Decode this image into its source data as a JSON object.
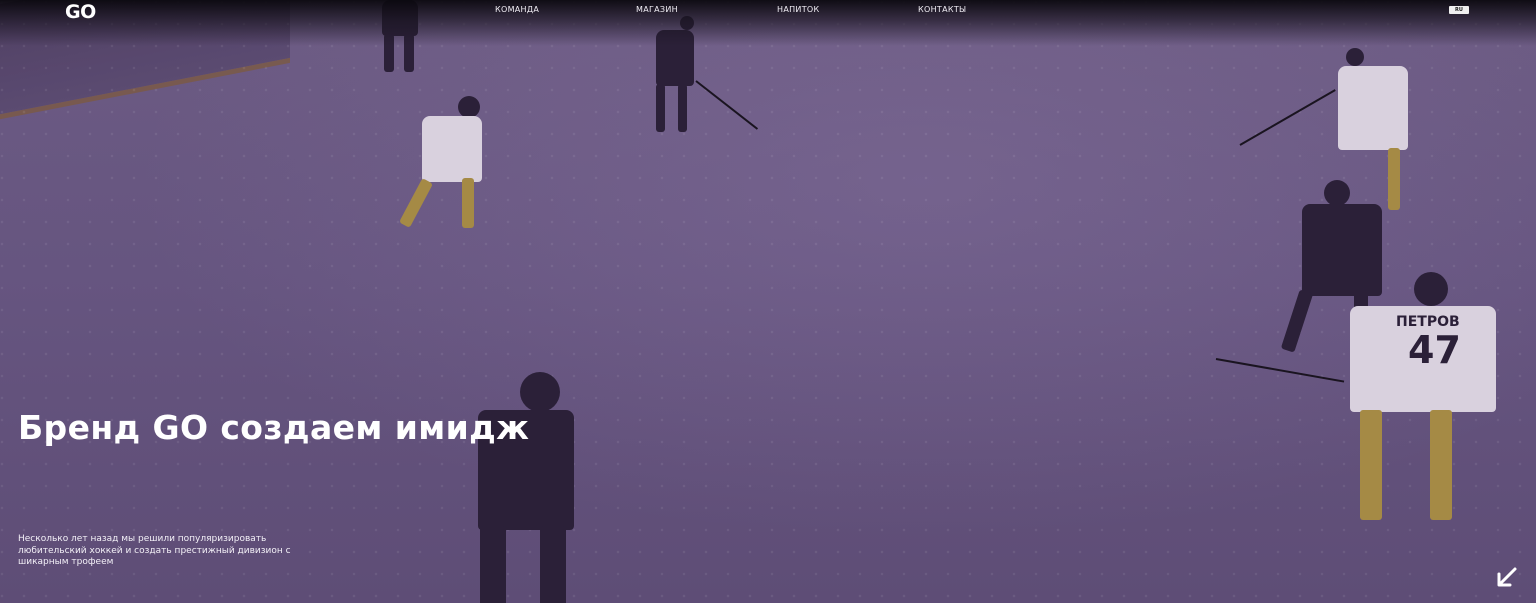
{
  "brand": {
    "logo_text": "GO"
  },
  "nav": {
    "items": [
      {
        "label": "КОМАНДА"
      },
      {
        "label": "МАГАЗИН"
      },
      {
        "label": "НАПИТОК"
      },
      {
        "label": "КОНТАКТЫ"
      }
    ],
    "language": "RU"
  },
  "hero": {
    "headline": "Бренд GO создаем имидж",
    "description": "Несколько лет назад мы решили популяризировать любительский хоккей и создать престижный дивизион с шикарным трофеем",
    "scroll_icon": "arrow-down-left-icon",
    "overlay_color": "#5f4d75"
  },
  "players": {
    "front_player_number": "47",
    "front_player_name": "ПЕТРОВ"
  }
}
